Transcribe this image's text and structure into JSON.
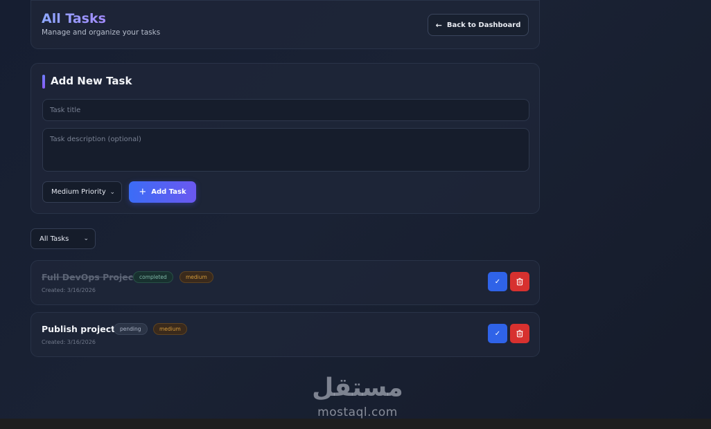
{
  "header": {
    "title": "All Tasks",
    "subtitle": "Manage and organize your tasks",
    "back_label": "Back to Dashboard",
    "back_icon": "arrow-left-icon"
  },
  "add_task": {
    "title": "Add New Task",
    "title_placeholder": "Task title",
    "description_placeholder": "Task description (optional)",
    "priority_value": "Medium Priority",
    "add_label": "Add Task",
    "add_icon": "plus-icon"
  },
  "filter": {
    "value": "All Tasks"
  },
  "tasks": [
    {
      "title": "Full DevOps Project",
      "status": "completed",
      "priority": "medium",
      "created": "Created: 3/16/2026"
    },
    {
      "title": "Publish project",
      "status": "pending",
      "priority": "medium",
      "created": "Created: 3/16/2026"
    }
  ],
  "watermark": {
    "arabic": "مستقل",
    "latin": "mostaql.com"
  },
  "colors": {
    "accent": "#3b6cf6",
    "danger": "#d7312f",
    "title_gradient_start": "#8ea8ff",
    "title_gradient_end": "#a38bff"
  }
}
